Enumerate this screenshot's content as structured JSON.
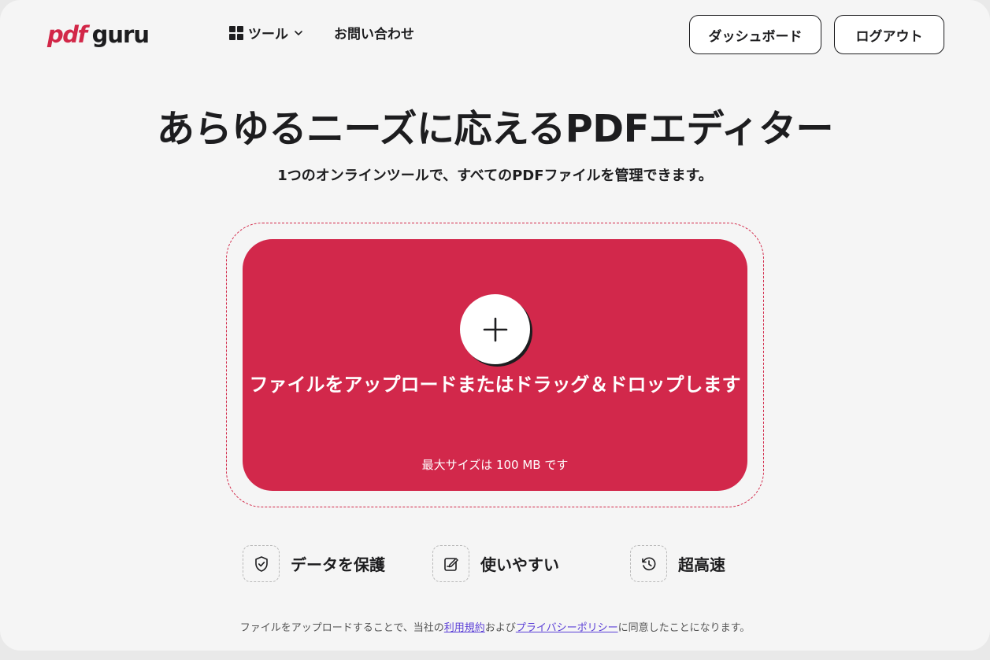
{
  "header": {
    "logo_pdf": "pdf",
    "logo_guru": "guru",
    "nav_tools": "ツール",
    "nav_contact": "お問い合わせ",
    "dashboard_button": "ダッシュボード",
    "logout_button": "ログアウト"
  },
  "hero": {
    "title": "あらゆるニーズに応えるPDFエディター",
    "subtitle": "1つのオンラインツールで、すべてのPDFファイルを管理できます。"
  },
  "upload": {
    "main_text": "ファイルをアップロードまたはドラッグ＆ドロップします",
    "max_size": "最大サイズは 100 MB です"
  },
  "features": [
    {
      "icon": "shield-check-icon",
      "label": "データを保護"
    },
    {
      "icon": "edit-note-icon",
      "label": "使いやすい"
    },
    {
      "icon": "history-clock-icon",
      "label": "超高速"
    }
  ],
  "consent": {
    "prefix": "ファイルをアップロードすることで、当社の",
    "terms_link": "利用規約",
    "middle": "および",
    "privacy_link": "プライバシーポリシー",
    "suffix": "に同意したことになります。"
  },
  "colors": {
    "brand": "#d22748",
    "background": "#f5f5f5",
    "text": "#1d1d1f",
    "link": "#5b3fd6"
  }
}
